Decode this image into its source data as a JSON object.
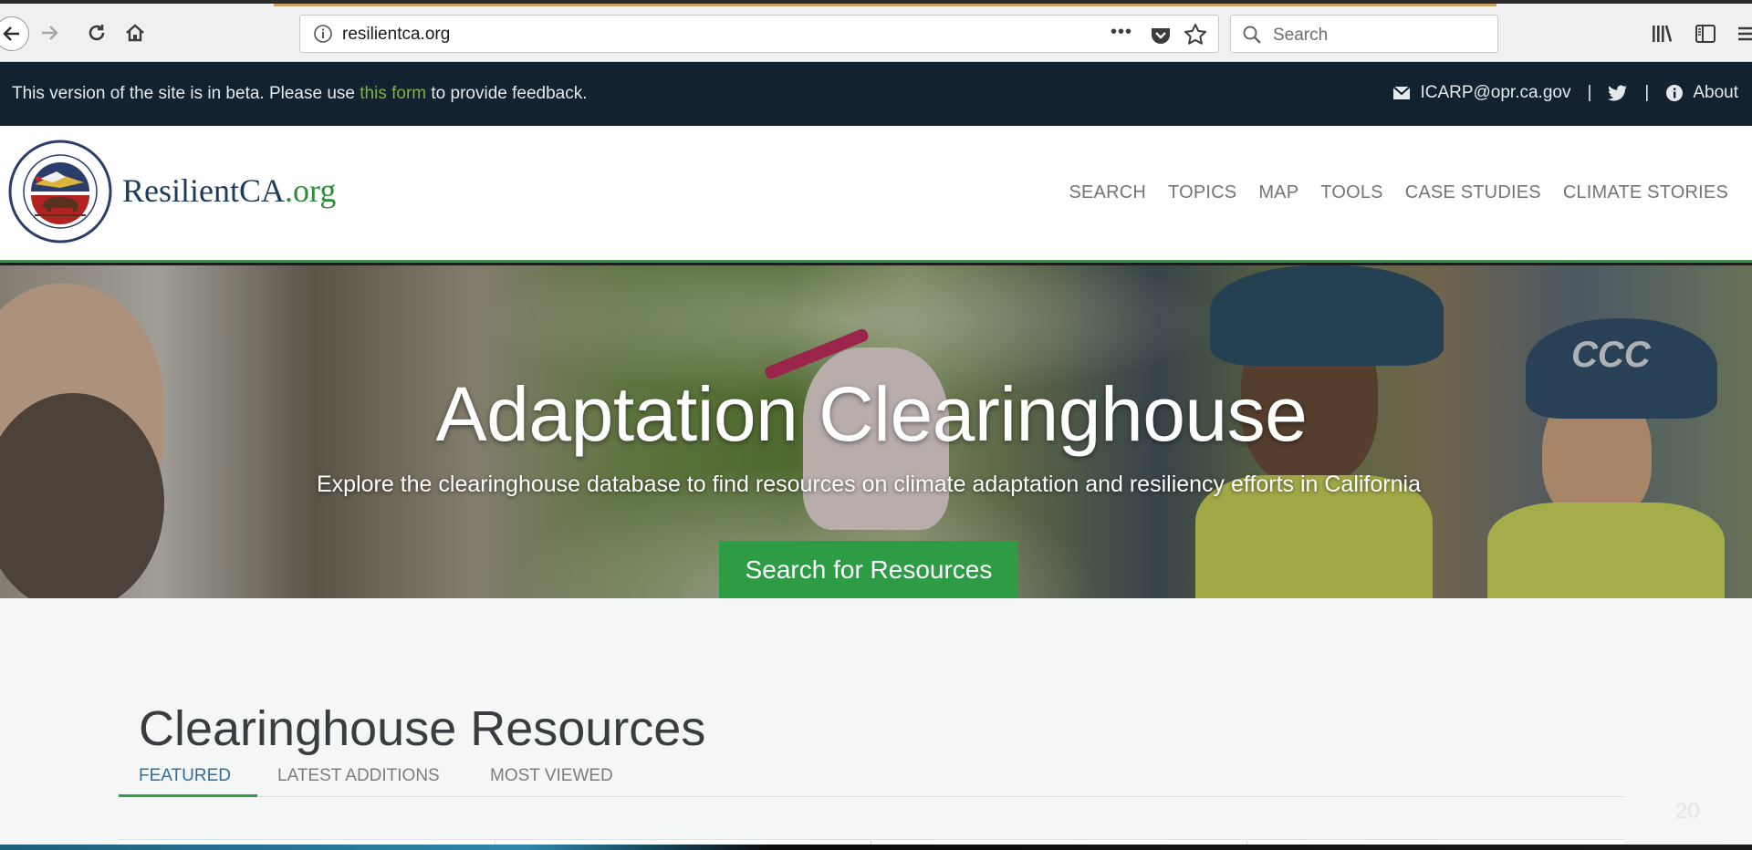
{
  "browser": {
    "url": "resilientca.org",
    "url_menu_glyph": "•••",
    "search_placeholder": "Search"
  },
  "beta_banner": {
    "text_before": "This version of the site is in beta. Please use ",
    "link_text": "this form",
    "text_after": " to provide feedback.",
    "email": "ICARP@opr.ca.gov",
    "separator": "|",
    "about_label": "About"
  },
  "header": {
    "brand_name": "ResilientCA",
    "brand_tld": ".org",
    "nav": [
      {
        "label": "SEARCH"
      },
      {
        "label": "TOPICS"
      },
      {
        "label": "MAP"
      },
      {
        "label": "TOOLS"
      },
      {
        "label": "CASE STUDIES"
      },
      {
        "label": "CLIMATE STORIES"
      }
    ]
  },
  "hero": {
    "title": "Adaptation Clearinghouse",
    "subtitle": "Explore the clearinghouse database to find resources on climate adaptation and resiliency efforts in California",
    "button_label": "Search for Resources",
    "helmet_text": "CCC"
  },
  "resources": {
    "title": "Clearinghouse Resources",
    "tabs": [
      {
        "label": "FEATURED",
        "active": true
      },
      {
        "label": "LATEST ADDITIONS",
        "active": false
      },
      {
        "label": "MOST VIEWED",
        "active": false
      }
    ],
    "slide_number": "20"
  },
  "colors": {
    "accent_green": "#2e9b45",
    "banner_bg": "#122230",
    "link_green": "#7cb342",
    "brand_blue": "#1f3a5a"
  },
  "icons": [
    "back-arrow-icon",
    "forward-arrow-icon",
    "reload-icon",
    "home-icon",
    "info-icon",
    "pocket-icon",
    "star-icon",
    "search-icon",
    "library-icon",
    "sidebar-icon",
    "menu-icon",
    "envelope-icon",
    "twitter-icon",
    "about-info-icon",
    "state-seal-logo"
  ]
}
